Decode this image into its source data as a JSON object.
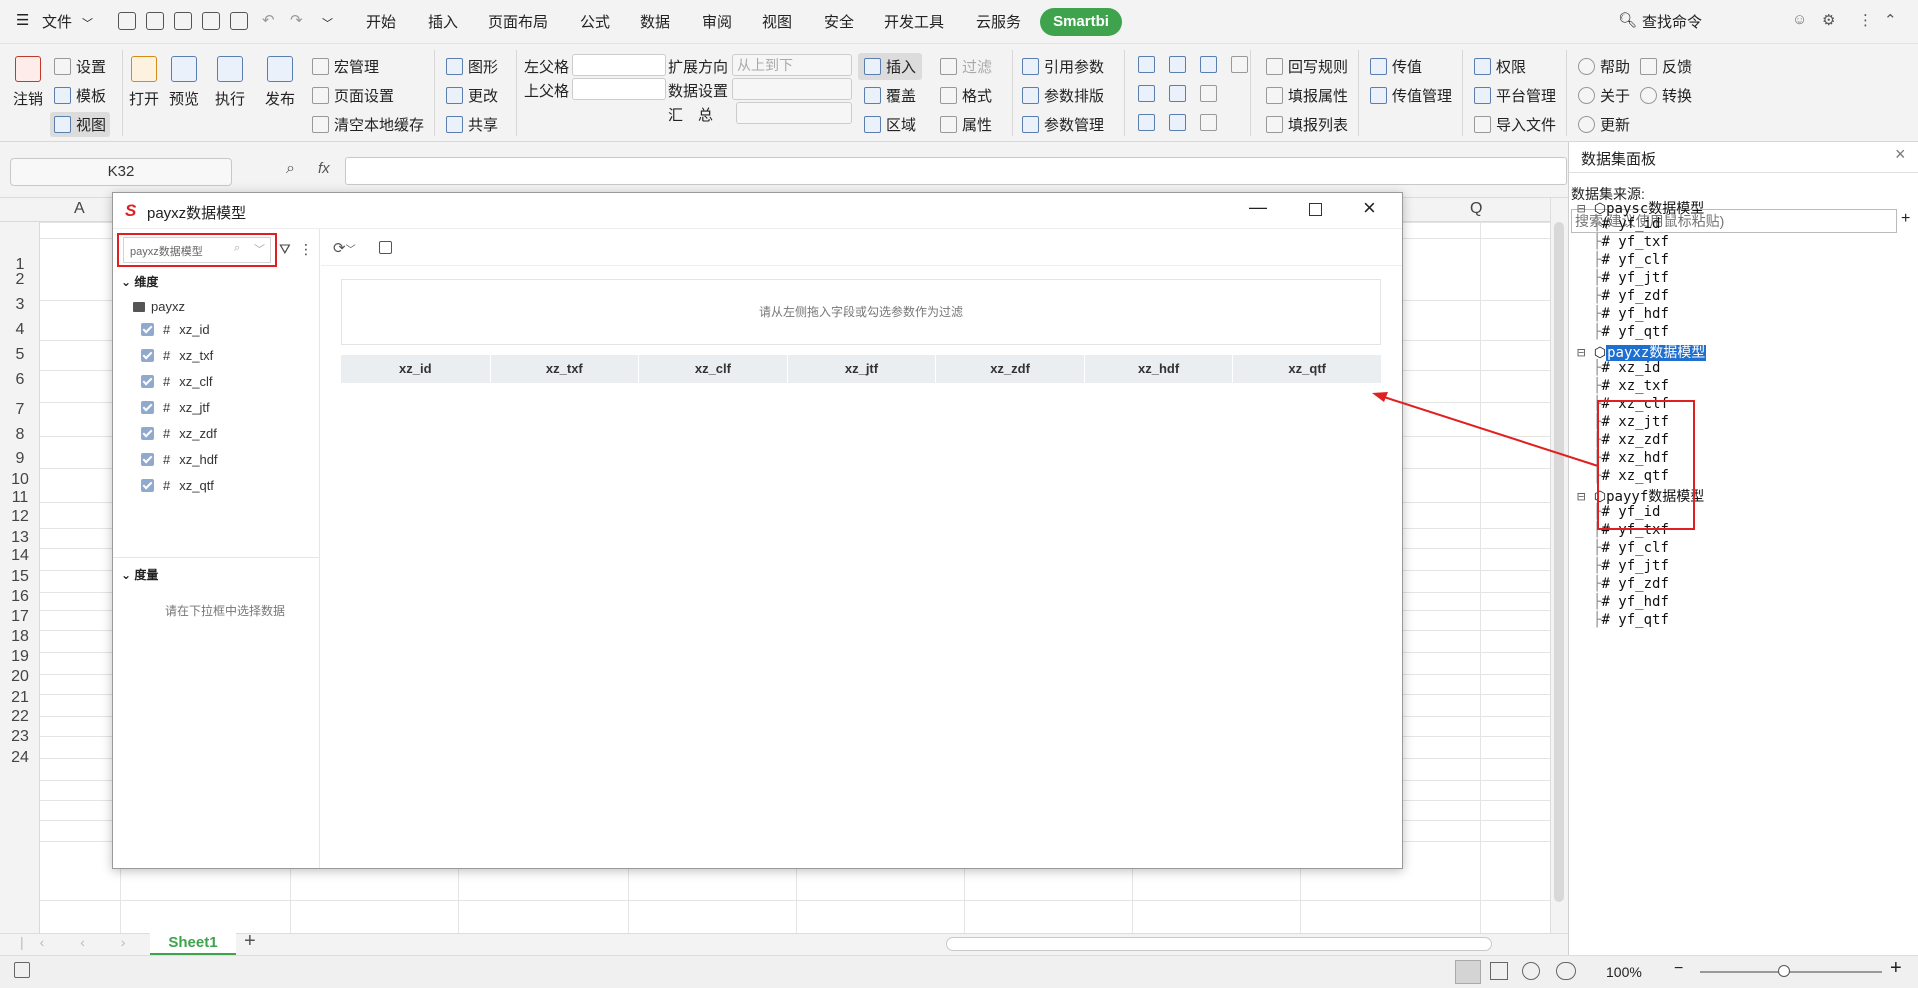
{
  "menubar": {
    "file_label": "文件",
    "tabs": [
      "开始",
      "插入",
      "页面布局",
      "公式",
      "数据",
      "审阅",
      "视图",
      "安全",
      "开发工具",
      "云服务"
    ],
    "smartbi_label": "Smartbi",
    "search_label": "查找命令"
  },
  "ribbon": {
    "logout": "注销",
    "settings": "设置",
    "template": "模板",
    "view": "视图",
    "open": "打开",
    "preview": "预览",
    "execute": "执行",
    "publish": "发布",
    "macro": "宏管理",
    "page_setup": "页面设置",
    "clear_cache": "清空本地缓存",
    "shape": "图形",
    "change": "更改",
    "share": "共享",
    "left_parent": "左父格",
    "up_parent": "上父格",
    "expand_dir": "扩展方向",
    "expand_dir_value": "从上到下",
    "data_setting": "数据设置",
    "summary": "汇　总",
    "insert": "插入",
    "cover": "覆盖",
    "region": "区域",
    "filter": "过滤",
    "format": "格式",
    "property": "属性",
    "ref_param": "引用参数",
    "param_layout": "参数排版",
    "param_manage": "参数管理",
    "writeback_rule": "回写规则",
    "fill_property": "填报属性",
    "fill_list": "填报列表",
    "pass_value": "传值",
    "pass_value_manage": "传值管理",
    "permission": "权限",
    "platform_manage": "平台管理",
    "import_file": "导入文件",
    "help": "帮助",
    "feedback": "反馈",
    "about": "关于",
    "convert": "转换",
    "update": "更新"
  },
  "formula_bar": {
    "cell_ref": "K32",
    "fx": "fx"
  },
  "sheet": {
    "col_a": "A",
    "col_q": "Q",
    "rows": [
      "1",
      "2",
      "3",
      "4",
      "5",
      "6",
      "7",
      "8",
      "9",
      "10",
      "11",
      "12",
      "13",
      "14",
      "15",
      "16",
      "17",
      "18",
      "19",
      "20",
      "21",
      "22",
      "23",
      "24"
    ],
    "tab": "Sheet1"
  },
  "dialog": {
    "title": "payxz数据模型",
    "model_select": "payxz数据模型",
    "dimension_label": "维度",
    "folder": "payxz",
    "fields": [
      "xz_id",
      "xz_txf",
      "xz_clf",
      "xz_jtf",
      "xz_zdf",
      "xz_hdf",
      "xz_qtf"
    ],
    "measure_label": "度量",
    "measure_hint": "请在下拉框中选择数据",
    "filter_hint": "请从左侧拖入字段或勾选参数作为过滤",
    "columns": [
      "xz_id",
      "xz_txf",
      "xz_clf",
      "xz_jtf",
      "xz_zdf",
      "xz_hdf",
      "xz_qtf"
    ]
  },
  "panel": {
    "title": "数据集面板",
    "source_label": "数据集来源:",
    "search_placeholder": "搜索(建议使用鼠标粘贴)",
    "models": [
      {
        "name": "paysc数据模型",
        "fields": [
          "yf_id",
          "yf_txf",
          "yf_clf",
          "yf_jtf",
          "yf_zdf",
          "yf_hdf",
          "yf_qtf"
        ]
      },
      {
        "name": "payxz数据模型",
        "fields": [
          "xz_id",
          "xz_txf",
          "xz_clf",
          "xz_jtf",
          "xz_zdf",
          "xz_hdf",
          "xz_qtf"
        ]
      },
      {
        "name": "payyf数据模型",
        "fields": [
          "yf_id",
          "yf_txf",
          "yf_clf",
          "yf_jtf",
          "yf_zdf",
          "yf_hdf",
          "yf_qtf"
        ]
      }
    ]
  },
  "status": {
    "zoom": "100%"
  },
  "colors": {
    "smartbi": "#3fa34d",
    "highlight": "#1e6fd0",
    "annotation": "#e02020"
  }
}
